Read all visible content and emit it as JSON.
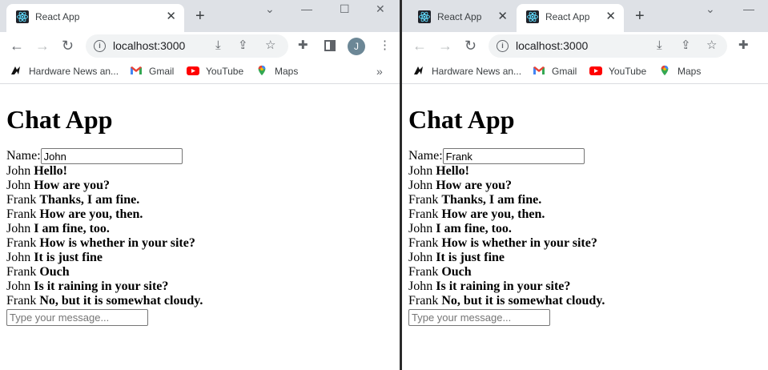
{
  "left_window": {
    "tab": {
      "title": "React App",
      "close": "✕"
    },
    "new_tab": "+",
    "controls": {
      "tab_search": "⌄",
      "minimize": "—",
      "maximize": "☐",
      "close": "✕"
    },
    "toolbar": {
      "back": "←",
      "forward": "→",
      "reload": "↻",
      "url": "localhost:3000",
      "avatar_letter": "J"
    },
    "bookmarks": [
      {
        "label": "Hardware News an...",
        "icon": "hardware-news-icon"
      },
      {
        "label": "Gmail",
        "icon": "gmail-icon"
      },
      {
        "label": "YouTube",
        "icon": "youtube-icon"
      },
      {
        "label": "Maps",
        "icon": "maps-icon"
      }
    ],
    "bookmarks_more": "»",
    "app": {
      "title": "Chat App",
      "name_label": "Name:",
      "name_value": "John",
      "messages": [
        {
          "user": "John",
          "text": "Hello!"
        },
        {
          "user": "John",
          "text": "How are you?"
        },
        {
          "user": "Frank",
          "text": "Thanks, I am fine."
        },
        {
          "user": "Frank",
          "text": "How are you, then."
        },
        {
          "user": "John",
          "text": "I am fine, too."
        },
        {
          "user": "Frank",
          "text": "How is whether in your site?"
        },
        {
          "user": "John",
          "text": "It is just fine"
        },
        {
          "user": "Frank",
          "text": "Ouch"
        },
        {
          "user": "John",
          "text": "Is it raining in your site?"
        },
        {
          "user": "Frank",
          "text": "No, but it is somewhat cloudy."
        }
      ],
      "message_placeholder": "Type your message..."
    }
  },
  "right_window": {
    "tabs": [
      {
        "title": "React App",
        "close": "✕"
      },
      {
        "title": "React App",
        "close": "✕"
      }
    ],
    "new_tab": "+",
    "controls": {
      "tab_search": "⌄",
      "minimize": "—"
    },
    "toolbar": {
      "back": "←",
      "forward": "→",
      "reload": "↻",
      "url": "localhost:3000"
    },
    "bookmarks": [
      {
        "label": "Hardware News an...",
        "icon": "hardware-news-icon"
      },
      {
        "label": "Gmail",
        "icon": "gmail-icon"
      },
      {
        "label": "YouTube",
        "icon": "youtube-icon"
      },
      {
        "label": "Maps",
        "icon": "maps-icon"
      }
    ],
    "app": {
      "title": "Chat App",
      "name_label": "Name:",
      "name_value": "Frank",
      "messages": [
        {
          "user": "John",
          "text": "Hello!"
        },
        {
          "user": "John",
          "text": "How are you?"
        },
        {
          "user": "Frank",
          "text": "Thanks, I am fine."
        },
        {
          "user": "Frank",
          "text": "How are you, then."
        },
        {
          "user": "John",
          "text": "I am fine, too."
        },
        {
          "user": "Frank",
          "text": "How is whether in your site?"
        },
        {
          "user": "John",
          "text": "It is just fine"
        },
        {
          "user": "Frank",
          "text": "Ouch"
        },
        {
          "user": "John",
          "text": "Is it raining in your site?"
        },
        {
          "user": "Frank",
          "text": "No, but it is somewhat cloudy."
        }
      ],
      "message_placeholder": "Type your message..."
    }
  }
}
